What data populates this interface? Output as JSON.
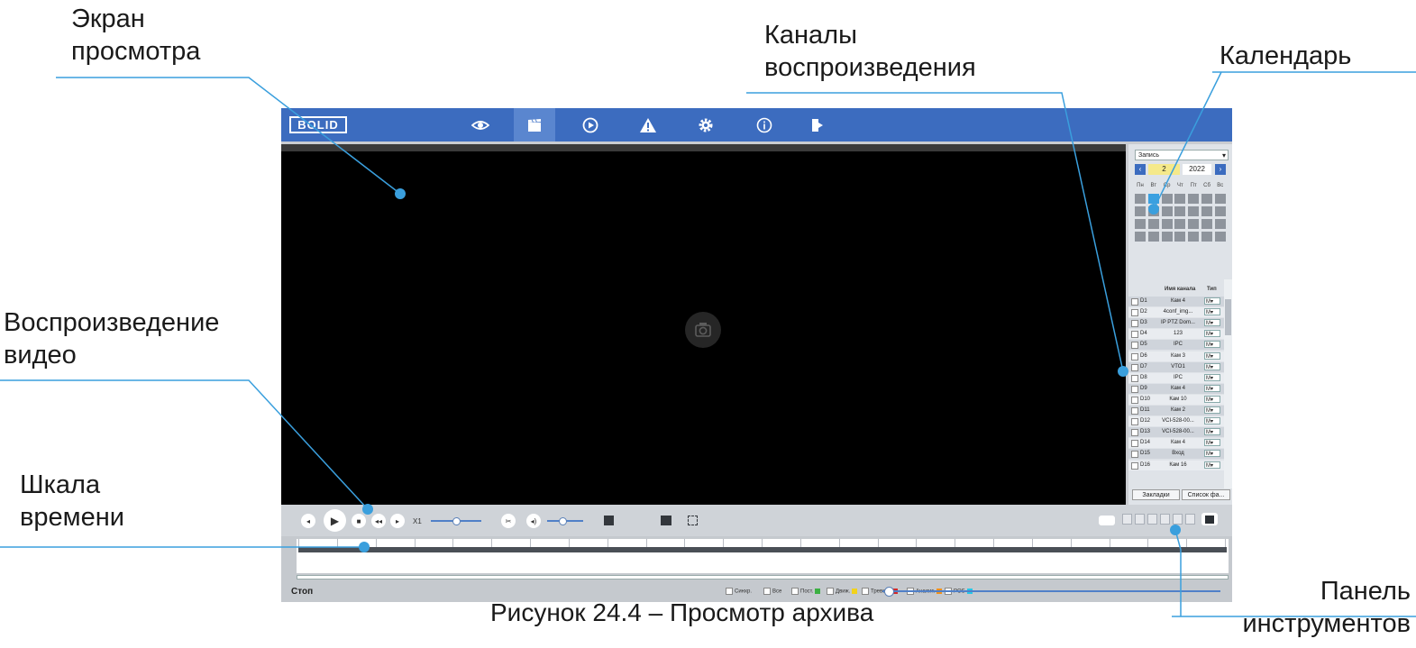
{
  "annotations": {
    "screen": [
      "Экран",
      "просмотра"
    ],
    "channels": [
      "Каналы",
      "воспроизведения"
    ],
    "calendar": "Календарь",
    "playback": [
      "Воспроизведение",
      "видео"
    ],
    "timescale": [
      "Шкала",
      "времени"
    ],
    "toolbar": [
      "Панель",
      "инструментов"
    ]
  },
  "caption": "Рисунок 24.4 – Просмотр архива",
  "app": {
    "logo": "BOLID",
    "accent_color": "#3c6cbf",
    "nav": [
      {
        "icon": "eye-icon",
        "active": false
      },
      {
        "icon": "clapperboard-icon",
        "active": true
      },
      {
        "icon": "play-circle-icon",
        "active": false
      },
      {
        "icon": "warning-icon",
        "active": false
      },
      {
        "icon": "gear-icon",
        "active": false
      },
      {
        "icon": "info-icon",
        "active": false
      },
      {
        "icon": "logout-icon",
        "active": false
      }
    ],
    "calendar": {
      "mode": "Запись",
      "month": "2",
      "year": "2022",
      "weekdays": [
        "Пн",
        "Вт",
        "Ср",
        "Чт",
        "Пт",
        "Сб",
        "Вс"
      ],
      "day_labels": [
        "",
        "",
        "",
        "",
        "",
        "",
        "",
        "",
        "",
        "",
        "",
        "",
        "",
        "",
        "",
        "",
        "",
        "",
        "",
        "",
        "",
        "",
        "",
        "",
        "",
        "",
        "",
        ""
      ],
      "selected_index": 1
    },
    "channels": {
      "header_name": "Имя канала",
      "header_type": "Тип",
      "rows": [
        {
          "id": "D1",
          "name": "Кам 4",
          "type": "M"
        },
        {
          "id": "D2",
          "name": "4conf_img...",
          "type": "M"
        },
        {
          "id": "D3",
          "name": "IP PTZ Dom...",
          "type": "M"
        },
        {
          "id": "D4",
          "name": "123",
          "type": "M"
        },
        {
          "id": "D5",
          "name": "IPC",
          "type": "M"
        },
        {
          "id": "D6",
          "name": "Кам 3",
          "type": "M"
        },
        {
          "id": "D7",
          "name": "VTO1",
          "type": "M"
        },
        {
          "id": "D8",
          "name": "IPC",
          "type": "M"
        },
        {
          "id": "D9",
          "name": "Кам 4",
          "type": "M"
        },
        {
          "id": "D10",
          "name": "Кам 10",
          "type": "M"
        },
        {
          "id": "D11",
          "name": "Кам 2",
          "type": "M"
        },
        {
          "id": "D12",
          "name": "VCI-528-00...",
          "type": "M"
        },
        {
          "id": "D13",
          "name": "VCI-528-00...",
          "type": "M"
        },
        {
          "id": "D14",
          "name": "Кам 4",
          "type": "M"
        },
        {
          "id": "D15",
          "name": "Вход",
          "type": "M"
        },
        {
          "id": "D16",
          "name": "Кам 16",
          "type": "M"
        }
      ],
      "bookmarks_label": "Закладки",
      "file_list_label": "Список фа..."
    },
    "controls": {
      "speed": "X1",
      "segment_buttons": [
        "",
        "",
        "",
        "",
        "",
        ""
      ]
    },
    "timeline": {
      "tick_labels": [
        "",
        "",
        "",
        "",
        "",
        "",
        "",
        "",
        "",
        "",
        "",
        "",
        "",
        "",
        "",
        "",
        "",
        "",
        "",
        "",
        "",
        "",
        "",
        "",
        ""
      ],
      "status": "Стоп",
      "legend": [
        {
          "label": "Синхр.",
          "color": ""
        },
        {
          "label": "Все",
          "color": ""
        },
        {
          "label": "Пост.",
          "color": "#3cb043"
        },
        {
          "label": "Движ.",
          "color": "#f2d21b"
        },
        {
          "label": "Тревога",
          "color": "#d42a2a"
        },
        {
          "label": "Аналит.",
          "color": "#f0901a"
        },
        {
          "label": "POS",
          "color": "#26c6e8"
        }
      ],
      "zoom_minus": "",
      "zoom_plus": ""
    }
  }
}
